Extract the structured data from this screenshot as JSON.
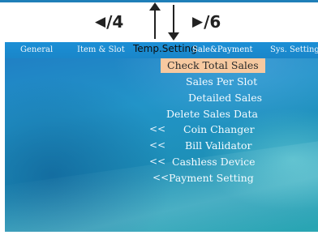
{
  "keys": {
    "left_label": "/4",
    "right_label": "/6"
  },
  "tabs": [
    {
      "label": "General"
    },
    {
      "label": "Item & Slot"
    },
    {
      "label": "Temp.Setting"
    },
    {
      "label": "Sale&Payment"
    },
    {
      "label": "Sys. Setting"
    }
  ],
  "menu": {
    "items": [
      {
        "label": "Check Total Sales",
        "selected": true
      },
      {
        "label": "Sales Per Slot"
      },
      {
        "label": "Detailed Sales"
      },
      {
        "label": "Delete Sales Data"
      },
      {
        "label": "Coin Changer",
        "submenu_marker": "<<"
      },
      {
        "label": "Bill Validator",
        "submenu_marker": "<<"
      },
      {
        "label": "Cashless Device",
        "submenu_marker": "<<"
      },
      {
        "label": "Payment Setting",
        "submenu_marker": "<<"
      }
    ]
  },
  "colors": {
    "tab_bar": "#1b8fd6",
    "selection": "#f7c9a0",
    "screen_bg": "#2294c8"
  }
}
